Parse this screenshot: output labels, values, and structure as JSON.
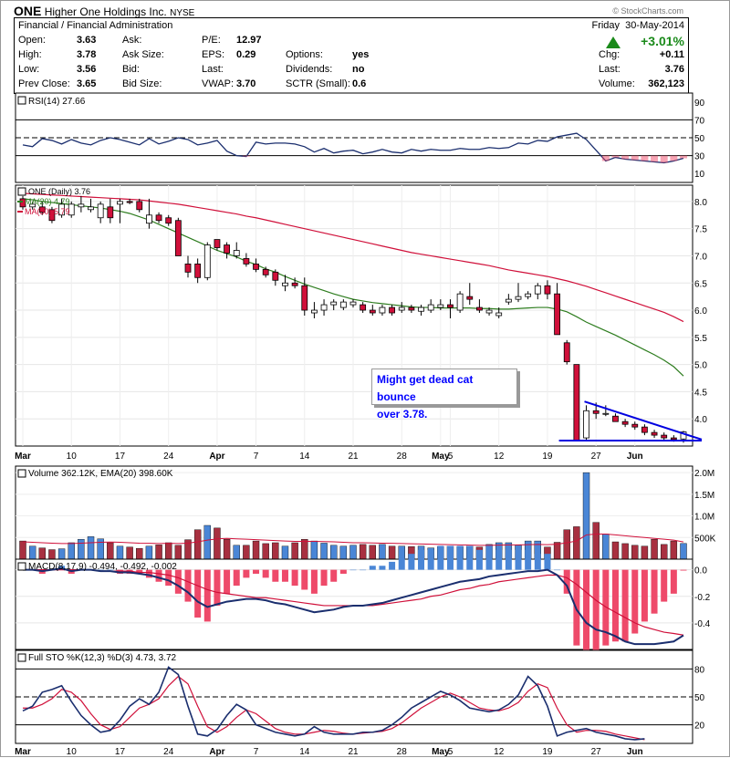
{
  "header": {
    "symbol": "ONE",
    "company": "Higher One Holdings Inc.",
    "exchange": "NYSE",
    "copyright": "© StockCharts.com",
    "sector": "Financial / Financial Administration",
    "day": "Friday",
    "date": "30-May-2014",
    "change_pct": "+3.01%",
    "quotes_left": [
      {
        "label": "Open:",
        "value": "3.63"
      },
      {
        "label": "High:",
        "value": "3.78"
      },
      {
        "label": "Low:",
        "value": "3.56"
      },
      {
        "label": "Prev Close:",
        "value": "3.65"
      }
    ],
    "quotes_mid": [
      {
        "label": "Ask:",
        "value": ""
      },
      {
        "label": "Ask Size:",
        "value": ""
      },
      {
        "label": "Bid:",
        "value": ""
      },
      {
        "label": "Bid Size:",
        "value": ""
      }
    ],
    "quotes_mid2": [
      {
        "label": "P/E:",
        "value": "12.97"
      },
      {
        "label": "EPS:",
        "value": "0.29"
      },
      {
        "label": "Last:",
        "value": ""
      },
      {
        "label": "VWAP:",
        "value": "3.70"
      }
    ],
    "quotes_mid3": [
      {
        "label": "Options:",
        "value": "yes"
      },
      {
        "label": "Dividends:",
        "value": "no"
      },
      {
        "label": "SCTR (Small):",
        "value": "0.6"
      }
    ],
    "quotes_right": [
      {
        "label": "Chg:",
        "value": "+0.11"
      },
      {
        "label": "Last:",
        "value": "3.76"
      },
      {
        "label": "Volume:",
        "value": "362,123"
      }
    ]
  },
  "annotation": {
    "line1": "Might get dead cat bounce",
    "line2": "over 3.78."
  },
  "colors": {
    "up_candle": "#ffffff",
    "down_candle": "#d0103a",
    "ma20": "#2e7d1f",
    "ma50": "#d0103a",
    "macd": "#1a2e6e",
    "signal": "#d0103a",
    "hist_pos": "#4a86d6",
    "hist_neg": "#ee4a6a",
    "vol_up": "#4a86d6",
    "vol_down": "#a83040",
    "trend": "#0000e0",
    "gain": "#1a8a1a"
  },
  "chart_data": [
    {
      "type": "line",
      "title": "RSI(14) 27.66",
      "y_ticks": [
        "90",
        "70",
        "50",
        "30",
        "10"
      ],
      "ylim": [
        0,
        100
      ],
      "lines": [
        70,
        50,
        30
      ],
      "values": [
        42,
        40,
        49,
        47,
        43,
        48,
        44,
        42,
        47,
        50,
        48,
        45,
        42,
        49,
        43,
        46,
        50,
        48,
        42,
        44,
        47,
        35,
        30,
        29,
        45,
        43,
        44,
        44,
        43,
        40,
        34,
        38,
        33,
        35,
        36,
        32,
        34,
        37,
        34,
        33,
        37,
        35,
        37,
        36,
        36,
        38,
        37,
        37,
        39,
        38,
        39,
        44,
        43,
        47,
        46,
        51,
        53,
        55,
        48,
        36,
        24,
        28,
        26,
        25,
        24,
        23,
        22,
        24,
        27
      ]
    },
    {
      "type": "candlestick",
      "title": "ONE (Daily) 3.76",
      "legend": [
        "MA(20) 4.79",
        "MA(50) 5.79"
      ],
      "y_ticks": [
        "8.0",
        "7.5",
        "7.0",
        "6.5",
        "6.0",
        "5.5",
        "5.0",
        "4.5",
        "4.0"
      ],
      "ylim": [
        3.5,
        8.3
      ],
      "x_labels": [
        {
          "i": 0,
          "label": "Mar"
        },
        {
          "i": 5,
          "label": "10"
        },
        {
          "i": 10,
          "label": "17"
        },
        {
          "i": 15,
          "label": "24"
        },
        {
          "i": 20,
          "label": "Apr"
        },
        {
          "i": 24,
          "label": "7"
        },
        {
          "i": 29,
          "label": "14"
        },
        {
          "i": 34,
          "label": "21"
        },
        {
          "i": 39,
          "label": "28"
        },
        {
          "i": 43,
          "label": "May"
        },
        {
          "i": 44,
          "label": "5"
        },
        {
          "i": 49,
          "label": "12"
        },
        {
          "i": 54,
          "label": "19"
        },
        {
          "i": 59,
          "label": "27"
        },
        {
          "i": 63,
          "label": "Jun"
        }
      ],
      "ohlc": [
        [
          8.05,
          8.1,
          7.85,
          7.9
        ],
        [
          7.9,
          8.0,
          7.85,
          7.95
        ],
        [
          7.9,
          8.0,
          7.75,
          7.8
        ],
        [
          7.85,
          7.9,
          7.6,
          7.65
        ],
        [
          7.75,
          8.05,
          7.7,
          7.95
        ],
        [
          7.75,
          8.0,
          7.7,
          7.95
        ],
        [
          7.9,
          8.1,
          7.8,
          7.95
        ],
        [
          7.85,
          8.05,
          7.8,
          7.9
        ],
        [
          7.7,
          8.0,
          7.6,
          7.95
        ],
        [
          7.9,
          8.05,
          7.6,
          7.7
        ],
        [
          7.95,
          8.05,
          7.6,
          8.0
        ],
        [
          8.0,
          8.05,
          7.95,
          7.98
        ],
        [
          8.0,
          8.05,
          7.8,
          7.85
        ],
        [
          7.6,
          8.05,
          7.5,
          7.75
        ],
        [
          7.75,
          7.8,
          7.6,
          7.65
        ],
        [
          7.7,
          7.75,
          7.55,
          7.6
        ],
        [
          7.65,
          7.7,
          7.05,
          7.0
        ],
        [
          6.85,
          7.0,
          6.6,
          6.7
        ],
        [
          6.85,
          6.95,
          6.5,
          6.6
        ],
        [
          6.6,
          7.25,
          6.55,
          7.2
        ],
        [
          7.3,
          7.3,
          7.1,
          7.15
        ],
        [
          7.2,
          7.25,
          6.95,
          7.05
        ],
        [
          7.0,
          7.25,
          6.95,
          7.1
        ],
        [
          6.95,
          7.05,
          6.8,
          6.85
        ],
        [
          6.85,
          6.95,
          6.7,
          6.75
        ],
        [
          6.75,
          6.8,
          6.6,
          6.65
        ],
        [
          6.7,
          6.75,
          6.45,
          6.55
        ],
        [
          6.45,
          6.65,
          6.35,
          6.5
        ],
        [
          6.5,
          6.6,
          6.4,
          6.45
        ],
        [
          6.45,
          6.6,
          5.9,
          6.0
        ],
        [
          5.95,
          6.15,
          5.85,
          6.0
        ],
        [
          6.0,
          6.2,
          5.9,
          6.1
        ],
        [
          6.1,
          6.2,
          6.0,
          6.15
        ],
        [
          6.05,
          6.2,
          6.0,
          6.15
        ],
        [
          6.1,
          6.2,
          6.05,
          6.15
        ],
        [
          6.1,
          6.15,
          5.95,
          6.0
        ],
        [
          6.0,
          6.1,
          5.9,
          5.95
        ],
        [
          5.95,
          6.1,
          5.9,
          6.05
        ],
        [
          6.05,
          6.1,
          5.9,
          5.95
        ],
        [
          6.0,
          6.15,
          5.95,
          6.05
        ],
        [
          6.05,
          6.1,
          5.95,
          6.0
        ],
        [
          5.98,
          6.1,
          5.9,
          6.05
        ],
        [
          6.0,
          6.2,
          5.95,
          6.1
        ],
        [
          6.05,
          6.2,
          6.0,
          6.1
        ],
        [
          6.1,
          6.2,
          5.85,
          6.05
        ],
        [
          6.0,
          6.35,
          5.95,
          6.3
        ],
        [
          6.25,
          6.5,
          6.1,
          6.2
        ],
        [
          6.05,
          6.2,
          5.95,
          6.0
        ],
        [
          5.95,
          6.05,
          5.9,
          6.0
        ],
        [
          5.9,
          6.05,
          5.85,
          5.95
        ],
        [
          6.15,
          6.3,
          6.1,
          6.2
        ],
        [
          6.2,
          6.5,
          6.15,
          6.25
        ],
        [
          6.25,
          6.35,
          6.2,
          6.3
        ],
        [
          6.3,
          6.5,
          6.2,
          6.45
        ],
        [
          6.45,
          6.55,
          6.2,
          6.3
        ],
        [
          6.3,
          6.5,
          5.95,
          5.55
        ],
        [
          5.4,
          5.45,
          5.0,
          5.05
        ],
        [
          5.0,
          5.0,
          4.2,
          3.6
        ],
        [
          3.65,
          4.25,
          3.6,
          4.15
        ],
        [
          4.15,
          4.3,
          4.0,
          4.1
        ],
        [
          4.1,
          4.25,
          4.05,
          4.1
        ],
        [
          4.05,
          4.1,
          3.95,
          3.95
        ],
        [
          3.95,
          4.0,
          3.85,
          3.9
        ],
        [
          3.9,
          3.95,
          3.8,
          3.85
        ],
        [
          3.85,
          3.9,
          3.7,
          3.75
        ],
        [
          3.75,
          3.8,
          3.65,
          3.7
        ],
        [
          3.7,
          3.75,
          3.6,
          3.65
        ],
        [
          3.65,
          3.7,
          3.58,
          3.62
        ],
        [
          3.63,
          3.78,
          3.56,
          3.76
        ]
      ],
      "ma20": [
        8.05,
        8.03,
        8.0,
        7.98,
        7.96,
        7.94,
        7.92,
        7.9,
        7.88,
        7.85,
        7.82,
        7.78,
        7.72,
        7.66,
        7.58,
        7.5,
        7.42,
        7.34,
        7.26,
        7.18,
        7.1,
        7.04,
        6.98,
        6.9,
        6.84,
        6.76,
        6.7,
        6.62,
        6.55,
        6.48,
        6.42,
        6.36,
        6.3,
        6.25,
        6.2,
        6.17,
        6.14,
        6.12,
        6.1,
        6.08,
        6.06,
        6.05,
        6.05,
        6.04,
        6.04,
        6.04,
        6.04,
        6.03,
        6.03,
        6.02,
        6.02,
        6.03,
        6.04,
        6.05,
        6.05,
        6.02,
        5.97,
        5.88,
        5.78,
        5.7,
        5.62,
        5.54,
        5.45,
        5.36,
        5.27,
        5.18,
        5.08,
        4.96,
        4.79
      ],
      "ma50": [
        8.15,
        8.14,
        8.13,
        8.12,
        8.11,
        8.1,
        8.09,
        8.08,
        8.07,
        8.06,
        8.05,
        8.04,
        8.03,
        8.01,
        7.99,
        7.97,
        7.95,
        7.92,
        7.89,
        7.86,
        7.83,
        7.8,
        7.77,
        7.73,
        7.7,
        7.66,
        7.62,
        7.58,
        7.54,
        7.5,
        7.46,
        7.42,
        7.38,
        7.34,
        7.3,
        7.26,
        7.22,
        7.18,
        7.14,
        7.1,
        7.06,
        7.03,
        7.0,
        6.97,
        6.94,
        6.91,
        6.88,
        6.85,
        6.82,
        6.78,
        6.74,
        6.71,
        6.68,
        6.65,
        6.62,
        6.58,
        6.54,
        6.49,
        6.44,
        6.38,
        6.32,
        6.26,
        6.2,
        6.14,
        6.08,
        6.02,
        5.96,
        5.88,
        5.79
      ]
    },
    {
      "type": "bar",
      "title": "Volume 362.12K, EMA(20) 398.60K",
      "y_ticks": [
        "2.0M",
        "1.5M",
        "1.0M",
        "500K"
      ],
      "ylim": [
        0,
        2150000
      ],
      "values": [
        420,
        300,
        260,
        220,
        240,
        380,
        460,
        520,
        470,
        380,
        300,
        280,
        250,
        300,
        330,
        380,
        320,
        450,
        680,
        780,
        720,
        460,
        320,
        320,
        420,
        360,
        380,
        300,
        380,
        460,
        420,
        370,
        320,
        300,
        320,
        340,
        320,
        340,
        300,
        300,
        290,
        300,
        260,
        290,
        300,
        290,
        300,
        280,
        340,
        380,
        380,
        320,
        420,
        420,
        280,
        390,
        680,
        750,
        2000,
        850,
        580,
        400,
        360,
        320,
        300,
        460,
        340,
        420,
        362
      ],
      "ema": [
        400,
        390,
        380,
        370,
        362,
        362,
        370,
        380,
        390,
        395,
        390,
        380,
        370,
        365,
        360,
        365,
        360,
        370,
        400,
        440,
        470,
        480,
        470,
        460,
        450,
        440,
        430,
        420,
        410,
        410,
        410,
        405,
        400,
        390,
        380,
        380,
        375,
        370,
        365,
        360,
        355,
        350,
        345,
        340,
        335,
        330,
        325,
        320,
        320,
        325,
        330,
        330,
        335,
        340,
        335,
        345,
        380,
        420,
        560,
        580,
        580,
        560,
        540,
        520,
        500,
        480,
        460,
        440,
        399
      ]
    },
    {
      "type": "bar",
      "title": "MACD(8,17,9) -0.494, -0.492, -0.002",
      "y_ticks": [
        "0.0",
        "-0.2",
        "-0.4"
      ],
      "ylim": [
        -0.6,
        0.08
      ],
      "macd": [
        0.0,
        0.0,
        -0.01,
        0.0,
        0.01,
        -0.01,
        0.0,
        0.0,
        -0.01,
        -0.01,
        -0.02,
        -0.02,
        -0.03,
        -0.04,
        -0.06,
        -0.08,
        -0.12,
        -0.17,
        -0.24,
        -0.28,
        -0.26,
        -0.24,
        -0.23,
        -0.22,
        -0.22,
        -0.23,
        -0.25,
        -0.26,
        -0.28,
        -0.3,
        -0.32,
        -0.31,
        -0.3,
        -0.28,
        -0.27,
        -0.27,
        -0.26,
        -0.25,
        -0.23,
        -0.21,
        -0.19,
        -0.17,
        -0.15,
        -0.13,
        -0.11,
        -0.09,
        -0.08,
        -0.07,
        -0.05,
        -0.04,
        -0.03,
        -0.02,
        -0.01,
        -0.01,
        0.0,
        -0.04,
        -0.12,
        -0.3,
        -0.4,
        -0.45,
        -0.47,
        -0.5,
        -0.54,
        -0.56,
        -0.56,
        -0.56,
        -0.55,
        -0.54,
        -0.494
      ],
      "signal": [
        0.0,
        0.0,
        0.0,
        0.0,
        0.0,
        0.0,
        0.0,
        0.0,
        -0.01,
        -0.01,
        -0.01,
        -0.01,
        -0.02,
        -0.02,
        -0.03,
        -0.04,
        -0.06,
        -0.09,
        -0.12,
        -0.15,
        -0.17,
        -0.18,
        -0.19,
        -0.2,
        -0.21,
        -0.21,
        -0.22,
        -0.23,
        -0.24,
        -0.25,
        -0.26,
        -0.27,
        -0.27,
        -0.27,
        -0.27,
        -0.27,
        -0.27,
        -0.26,
        -0.25,
        -0.24,
        -0.23,
        -0.22,
        -0.2,
        -0.19,
        -0.17,
        -0.15,
        -0.14,
        -0.12,
        -0.11,
        -0.09,
        -0.08,
        -0.07,
        -0.06,
        -0.05,
        -0.04,
        -0.04,
        -0.06,
        -0.11,
        -0.17,
        -0.23,
        -0.28,
        -0.32,
        -0.36,
        -0.4,
        -0.43,
        -0.45,
        -0.47,
        -0.48,
        -0.492
      ]
    },
    {
      "type": "line",
      "title": "Full STO %K(12,3) %D(3) 4.73, 3.72",
      "y_ticks": [
        "80",
        "50",
        "20"
      ],
      "ylim": [
        0,
        100
      ],
      "lines": [
        80,
        50,
        20
      ],
      "k": [
        35,
        40,
        55,
        58,
        62,
        45,
        30,
        20,
        12,
        14,
        25,
        40,
        48,
        42,
        55,
        82,
        74,
        40,
        10,
        8,
        15,
        30,
        42,
        36,
        20,
        16,
        12,
        10,
        8,
        10,
        18,
        12,
        10,
        10,
        10,
        12,
        12,
        14,
        20,
        28,
        38,
        44,
        50,
        56,
        52,
        46,
        38,
        36,
        34,
        36,
        42,
        52,
        72,
        62,
        40,
        8,
        12,
        14,
        16,
        12,
        10,
        8,
        5,
        4,
        5
      ],
      "d": [
        38,
        38,
        42,
        48,
        58,
        55,
        46,
        32,
        20,
        15,
        18,
        28,
        38,
        42,
        48,
        62,
        72,
        64,
        40,
        18,
        12,
        18,
        28,
        36,
        32,
        24,
        16,
        12,
        10,
        10,
        12,
        14,
        13,
        11,
        10,
        11,
        12,
        13,
        16,
        22,
        30,
        38,
        44,
        50,
        54,
        50,
        44,
        38,
        36,
        35,
        38,
        44,
        56,
        64,
        60,
        38,
        20,
        12,
        14,
        14,
        13,
        10,
        8,
        6,
        4
      ]
    }
  ]
}
